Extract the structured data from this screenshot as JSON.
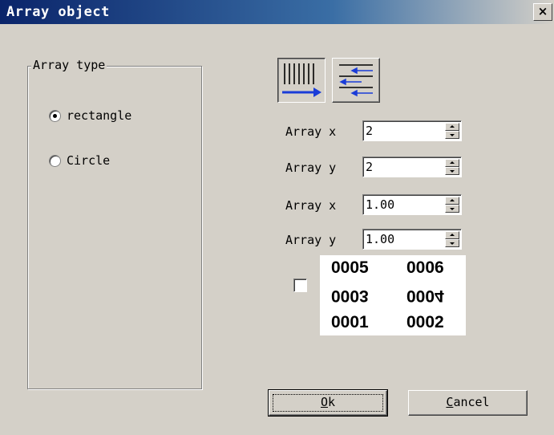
{
  "window": {
    "title": "Array object",
    "close_glyph": "×"
  },
  "array_type": {
    "legend": "Array type",
    "options": [
      {
        "label": "rectangle",
        "checked": true
      },
      {
        "label": "Circle",
        "checked": false
      }
    ]
  },
  "modes": [
    {
      "icon": "columns-right-arrow-icon",
      "pressed": true
    },
    {
      "icon": "rows-left-arrows-icon",
      "pressed": false
    }
  ],
  "fields": [
    {
      "label": "Array x",
      "value": "2"
    },
    {
      "label": "Array y",
      "value": "2"
    },
    {
      "label": "Array x",
      "value": "1.00"
    },
    {
      "label": "Array y",
      "value": "1.00"
    }
  ],
  "order": {
    "checked": false,
    "cells": [
      {
        "text": "0005",
        "flipped": false
      },
      {
        "text": "0006",
        "flipped": false
      },
      {
        "text": "0003",
        "flipped": true
      },
      {
        "text": "0004",
        "flipped": true
      },
      {
        "text": "0001",
        "flipped": false
      },
      {
        "text": "0002",
        "flipped": false
      }
    ]
  },
  "buttons": {
    "ok_mnemonic": "O",
    "ok_rest": "k",
    "cancel_mnemonic": "C",
    "cancel_rest": "ancel"
  },
  "colors": {
    "title_start": "#0a246a",
    "title_end": "#3a6ea5",
    "face": "#d4d0c8"
  }
}
